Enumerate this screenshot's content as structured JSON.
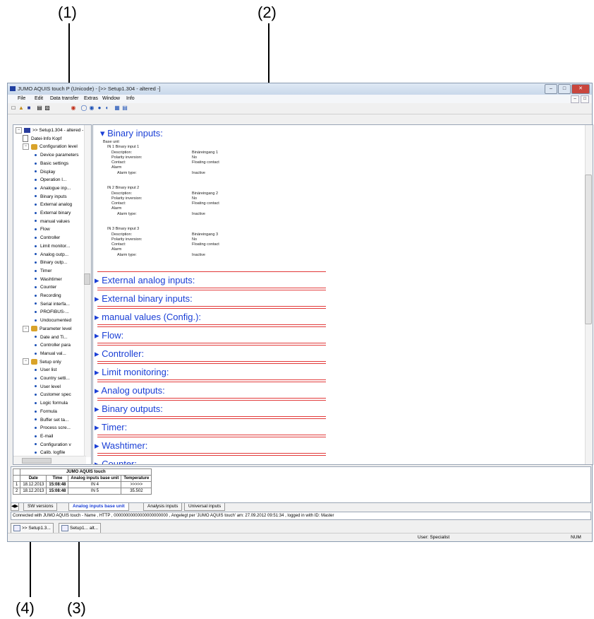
{
  "callouts": {
    "c1": "(1)",
    "c2": "(2)",
    "c3": "(3)",
    "c4": "(4)"
  },
  "window": {
    "title": "JUMO AQUIS touch P (Unicode) - [>> Setup1.304 - altered -]",
    "menu": [
      "File",
      "Edit",
      "Data transfer",
      "Extras",
      "Window",
      "Info"
    ]
  },
  "tree": [
    {
      "level": 0,
      "kind": "root",
      "label": ">> Setup1.304 - altered -"
    },
    {
      "level": 1,
      "kind": "doc",
      "label": "Datei-Info Kopf"
    },
    {
      "level": 1,
      "kind": "folder",
      "label": "Configuration level"
    },
    {
      "level": 2,
      "kind": "item",
      "label": "Device parameters"
    },
    {
      "level": 2,
      "kind": "item",
      "label": "Basic settings"
    },
    {
      "level": 2,
      "kind": "item",
      "label": "Display"
    },
    {
      "level": 2,
      "kind": "item",
      "label": "Operation l..."
    },
    {
      "level": 2,
      "kind": "item",
      "label": "Analogue inp..."
    },
    {
      "level": 2,
      "kind": "item",
      "label": "Binary inputs"
    },
    {
      "level": 2,
      "kind": "item",
      "label": "External analog"
    },
    {
      "level": 2,
      "kind": "item",
      "label": "External binary"
    },
    {
      "level": 2,
      "kind": "item",
      "label": "manual values"
    },
    {
      "level": 2,
      "kind": "item",
      "label": "Flow"
    },
    {
      "level": 2,
      "kind": "item",
      "label": "Controller"
    },
    {
      "level": 2,
      "kind": "item",
      "label": "Limit monitor..."
    },
    {
      "level": 2,
      "kind": "item",
      "label": "Analog outp..."
    },
    {
      "level": 2,
      "kind": "item",
      "label": "Binary outp..."
    },
    {
      "level": 2,
      "kind": "item",
      "label": "Timer"
    },
    {
      "level": 2,
      "kind": "item",
      "label": "Washtimer"
    },
    {
      "level": 2,
      "kind": "item",
      "label": "Counter"
    },
    {
      "level": 2,
      "kind": "item",
      "label": "Recording"
    },
    {
      "level": 2,
      "kind": "item",
      "label": "Serial interfa..."
    },
    {
      "level": 2,
      "kind": "item",
      "label": "PROFIBUS-..."
    },
    {
      "level": 2,
      "kind": "item",
      "label": "Undocumented"
    },
    {
      "level": 1,
      "kind": "folder",
      "label": "Parameter level"
    },
    {
      "level": 2,
      "kind": "item",
      "label": "Date and Ti..."
    },
    {
      "level": 2,
      "kind": "item",
      "label": "Controller para"
    },
    {
      "level": 2,
      "kind": "item",
      "label": "Manual val..."
    },
    {
      "level": 1,
      "kind": "folder",
      "label": "Setup only"
    },
    {
      "level": 2,
      "kind": "item",
      "label": "User list"
    },
    {
      "level": 2,
      "kind": "item",
      "label": "Country setti..."
    },
    {
      "level": 2,
      "kind": "item",
      "label": "User level"
    },
    {
      "level": 2,
      "kind": "item",
      "label": "Customer spec"
    },
    {
      "level": 2,
      "kind": "item",
      "label": "Logic formula"
    },
    {
      "level": 2,
      "kind": "item",
      "label": "Formula"
    },
    {
      "level": 2,
      "kind": "item",
      "label": "Buffer set ta..."
    },
    {
      "level": 2,
      "kind": "item",
      "label": "Process scre..."
    },
    {
      "level": 2,
      "kind": "item",
      "label": "E-mail"
    },
    {
      "level": 2,
      "kind": "item",
      "label": "Configuration v"
    },
    {
      "level": 2,
      "kind": "item",
      "label": "Calib. logfile"
    }
  ],
  "main": {
    "binary_title": "Binary inputs:",
    "base_unit": "Base unit",
    "inputs": [
      {
        "header": "IN 1  Binary input 1",
        "desc": "Binäreingang 1",
        "pol": "No",
        "contact": "Floating contact",
        "alarm_type": "Inactive"
      },
      {
        "header": "IN 2  Binary input 2",
        "desc": "Binäreingang 2",
        "pol": "No",
        "contact": "Floating contact",
        "alarm_type": "Inactive"
      },
      {
        "header": "IN 3  Binary input 3",
        "desc": "Binäreingang 3",
        "pol": "No",
        "contact": "Floating contact",
        "alarm_type": "Inactive"
      }
    ],
    "labels": {
      "description": "Description:",
      "polarity": "Polarity inversion:",
      "contact": "Contact:",
      "alarm": "Alarm",
      "alarm_type": "Alarm type:"
    },
    "sections": [
      "External analog inputs:",
      "External binary inputs:",
      "manual values (Config.):",
      "Flow:",
      "Controller:",
      "Limit monitoring:",
      "Analog outputs:",
      "Binary outputs:",
      "Timer:",
      "Washtimer:",
      "Counter:"
    ]
  },
  "log": {
    "title": "JUMO AQUIS touch",
    "headers": [
      "Date",
      "Time",
      "Analog inputs base unit",
      "Temperature"
    ],
    "subheaders": [
      "",
      "",
      "",
      ""
    ],
    "rows": [
      {
        "n": "1",
        "date": "18.12.2013",
        "time": "15:08:48",
        "input": "IN 4",
        "temp": ">>>>>"
      },
      {
        "n": "2",
        "date": "18.12.2013",
        "time": "15:08:48",
        "input": "IN 5",
        "temp": "35.502"
      }
    ]
  },
  "log_tabs": [
    "SW versions",
    "Analog inputs base unit",
    "Analysis inputs",
    "Universal inputs"
  ],
  "status_line": "Connected with JUMO AQUIS touch - Name , HTTP , 00000000000000000000000 , Angelegt per 'JUMO AQUIS touch' am: 27.09.2012 09:51:34 , logged in with ID: Master",
  "doc_tabs": [
    ">> Setup1.3...",
    "Setup1... alt..."
  ],
  "statusbar": {
    "user": "User: Specialist",
    "num": "NUM"
  }
}
